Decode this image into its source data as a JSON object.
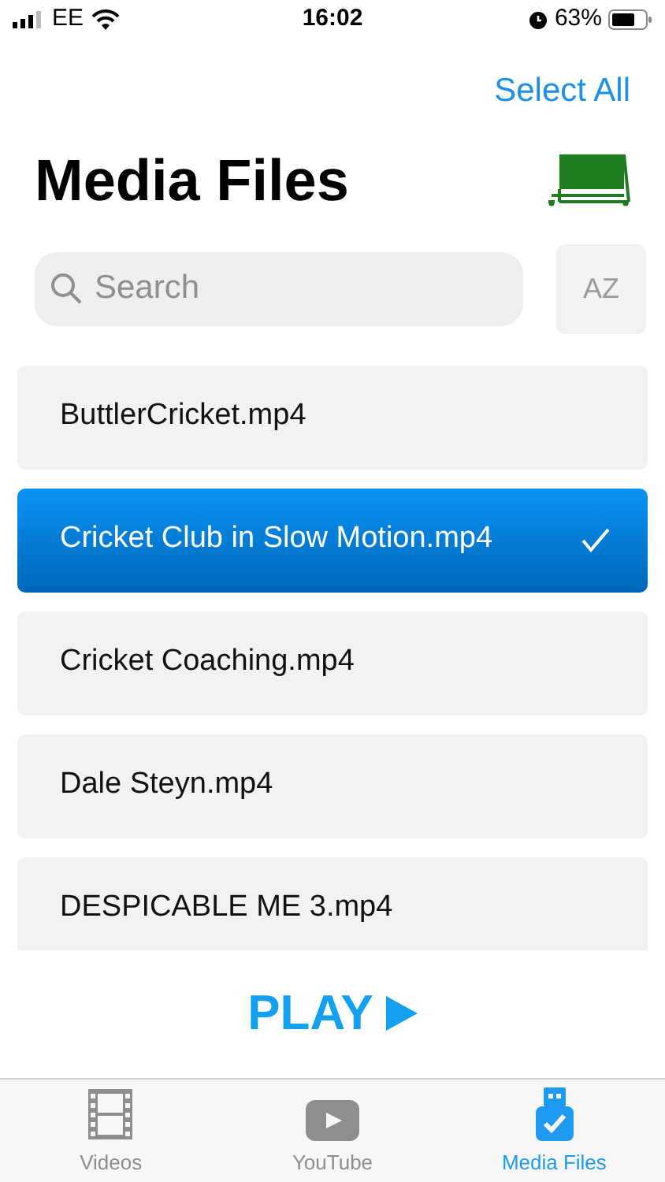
{
  "status_bar": {
    "carrier": "EE",
    "time": "16:02",
    "battery": "63%"
  },
  "header": {
    "action": "Select All",
    "title": "Media Files"
  },
  "search": {
    "placeholder": "Search"
  },
  "sort_button": "AZ",
  "files": [
    {
      "name": "ButtlerCricket.mp4",
      "selected": false
    },
    {
      "name": "Cricket Club in Slow Motion.mp4",
      "selected": true
    },
    {
      "name": "Cricket Coaching.mp4",
      "selected": false
    },
    {
      "name": "Dale Steyn.mp4",
      "selected": false
    },
    {
      "name": "DESPICABLE ME 3.mp4",
      "selected": false
    }
  ],
  "play_button": "PLAY",
  "tabs": [
    {
      "label": "Videos",
      "kind": "film",
      "selected": false
    },
    {
      "label": "YouTube",
      "kind": "youtube",
      "selected": false
    },
    {
      "label": "Media Files",
      "kind": "usb",
      "selected": true
    }
  ]
}
